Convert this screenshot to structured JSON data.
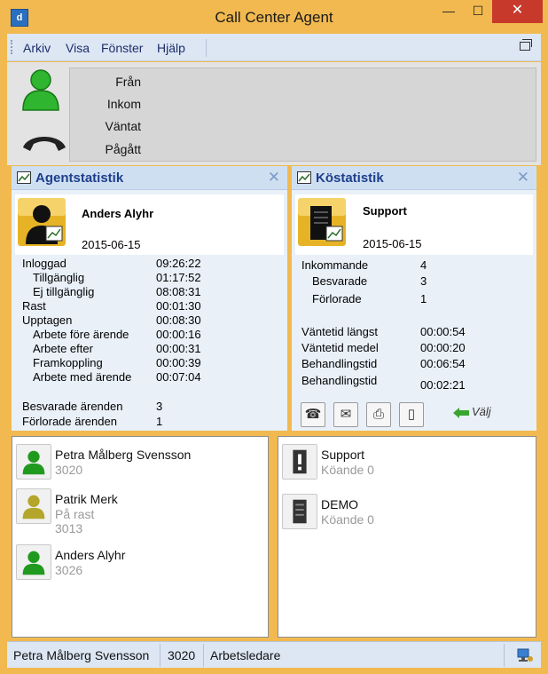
{
  "window": {
    "title": "Call Center Agent",
    "app_icon": "d"
  },
  "menu": {
    "items": [
      "Arkiv",
      "Visa",
      "Fönster",
      "Hjälp"
    ]
  },
  "call": {
    "labels": [
      "Från",
      "Inkom",
      "Väntat",
      "Pågått"
    ]
  },
  "agent_stats": {
    "title": "Agentstatistik",
    "name": "Anders Alyhr",
    "date": "2015-06-15",
    "rows": [
      {
        "label": "Inloggad",
        "value": "09:26:22",
        "indent": 0
      },
      {
        "label": "Tillgänglig",
        "value": "01:17:52",
        "indent": 1
      },
      {
        "label": "Ej tillgänglig",
        "value": "08:08:31",
        "indent": 1
      },
      {
        "label": "Rast",
        "value": "00:01:30",
        "indent": 0
      },
      {
        "label": "Upptagen",
        "value": "00:08:30",
        "indent": 0
      },
      {
        "label": "Arbete före ärende",
        "value": "00:00:16",
        "indent": 2
      },
      {
        "label": "Arbete efter",
        "value": "00:00:31",
        "indent": 2
      },
      {
        "label": "Framkoppling",
        "value": "00:00:39",
        "indent": 2
      },
      {
        "label": "Arbete med ärende",
        "value": "00:07:04",
        "indent": 2
      },
      {
        "label": "Besvarade ärenden",
        "value": "3",
        "indent": 0
      },
      {
        "label": "Förlorade ärenden",
        "value": "1",
        "indent": 0
      }
    ]
  },
  "queue_stats": {
    "title": "Köstatistik",
    "name": "Support",
    "date": "2015-06-15",
    "rows": [
      {
        "label": "Inkommande",
        "value": "4",
        "indent": 0
      },
      {
        "label": "Besvarade",
        "value": "3",
        "indent": 1
      },
      {
        "label": "Förlorade",
        "value": "1",
        "indent": 1
      },
      {
        "label": "Väntetid längst",
        "value": "00:00:54",
        "indent": 0
      },
      {
        "label": "Väntetid medel",
        "value": "00:00:20",
        "indent": 0
      },
      {
        "label": "Behandlingstid",
        "value": "00:06:54",
        "indent": 0
      },
      {
        "label": "Behandlingstid",
        "value": "00:02:21",
        "indent": 0
      }
    ],
    "tool_icons": [
      "phone-icon",
      "mail-icon",
      "fax-icon",
      "mobile-icon"
    ],
    "select_label": "Välj"
  },
  "agents": [
    {
      "name": "Petra Målberg Svensson",
      "lines": [
        "3020"
      ],
      "status_color": "#1f9a1f"
    },
    {
      "name": "Patrik Merk",
      "lines": [
        "På rast",
        "3013"
      ],
      "status_color": "#b3a62a"
    },
    {
      "name": "Anders Alyhr",
      "lines": [
        "3026"
      ],
      "status_color": "#1f9a1f"
    }
  ],
  "queues": [
    {
      "name": "Support",
      "lines": [
        "Köande 0"
      ]
    },
    {
      "name": "DEMO",
      "lines": [
        "Köande 0"
      ]
    }
  ],
  "status": {
    "user": "Petra Målberg Svensson",
    "ext": "3020",
    "role": "Arbetsledare"
  }
}
